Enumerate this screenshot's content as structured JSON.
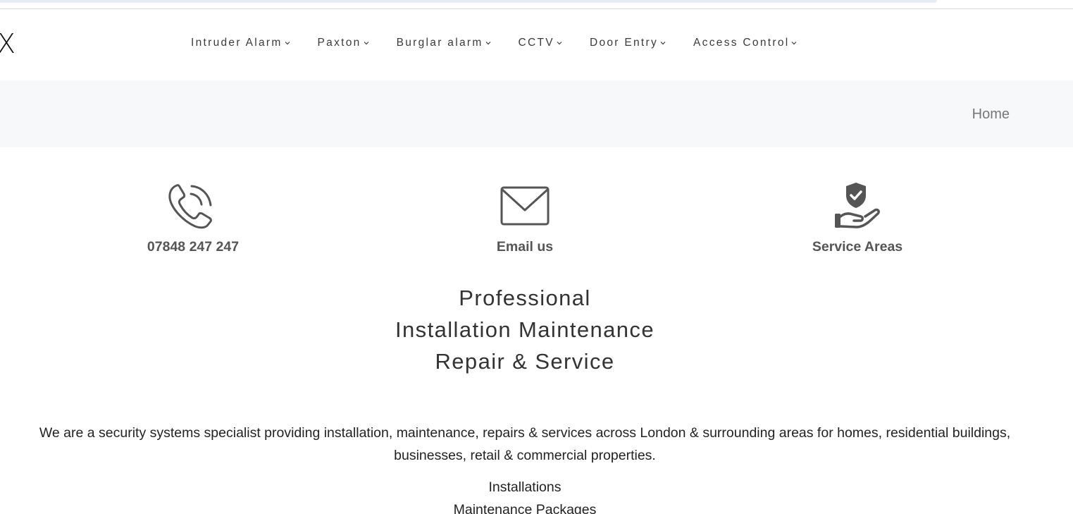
{
  "logo": {
    "fragment": "X"
  },
  "nav": {
    "items": [
      {
        "label": "Intruder Alarm"
      },
      {
        "label": "Paxton"
      },
      {
        "label": "Burglar alarm"
      },
      {
        "label": "CCTV"
      },
      {
        "label": "Door Entry"
      },
      {
        "label": "Access Control"
      }
    ]
  },
  "breadcrumb": {
    "home": "Home"
  },
  "features": {
    "phone": {
      "label": "07848 247 247",
      "icon": "phone-icon"
    },
    "email": {
      "label": "Email us",
      "icon": "envelope-icon"
    },
    "areas": {
      "label": "Service Areas",
      "icon": "shield-hand-icon"
    }
  },
  "heading": {
    "line1": "Professional",
    "line2": "Installation Maintenance",
    "line3": "Repair & Service"
  },
  "intro": {
    "text": "We are a security systems specialist providing installation, maintenance, repairs & services across London & surrounding areas for homes, residential buildings, businesses, retail & commercial properties."
  },
  "services": {
    "items": [
      "Installations",
      "Maintenance Packages"
    ]
  },
  "colors": {
    "breadcrumb_bg": "#f7f8fa",
    "icon": "#555555",
    "text": "#333333"
  }
}
